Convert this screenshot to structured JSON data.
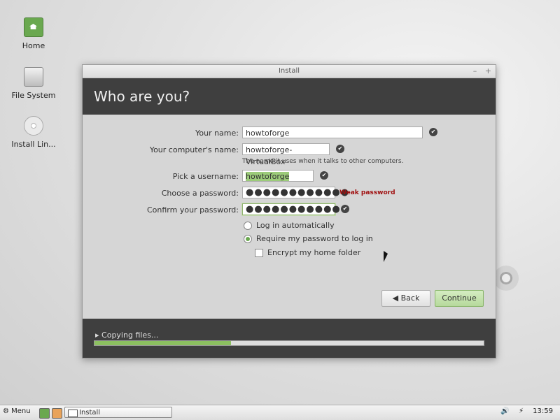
{
  "desktop": {
    "icons": [
      {
        "label": "Home"
      },
      {
        "label": "File System"
      },
      {
        "label": "Install Lin..."
      }
    ]
  },
  "window": {
    "title": "Install",
    "header": "Who are you?",
    "form": {
      "your_name_label": "Your name:",
      "your_name_value": "howtoforge",
      "computer_name_label": "Your computer's name:",
      "computer_name_value": "howtoforge-VirtualBox",
      "computer_name_hint": "The name it uses when it talks to other computers.",
      "username_label": "Pick a username:",
      "username_value": "howtoforge",
      "password_label": "Choose a password:",
      "password_value": "●●●●●●●●●●●●",
      "password_strength": "Weak password",
      "confirm_label": "Confirm your password:",
      "confirm_value": "●●●●●●●●●●●●"
    },
    "options": {
      "login_auto": "Log in automatically",
      "require_password": "Require my password to log in",
      "encrypt_home": "Encrypt my home folder",
      "selected": "require_password",
      "encrypt_checked": false
    },
    "buttons": {
      "back": "Back",
      "continue": "Continue"
    },
    "progress": {
      "label": "Copying files...",
      "fraction": 0.35
    }
  },
  "taskbar": {
    "menu_label": "Menu",
    "task_label": "Install",
    "clock": "13:59"
  },
  "colors": {
    "accent_green": "#8cc060",
    "header_dark": "#3f3f3f",
    "weak_red": "#a01010"
  }
}
